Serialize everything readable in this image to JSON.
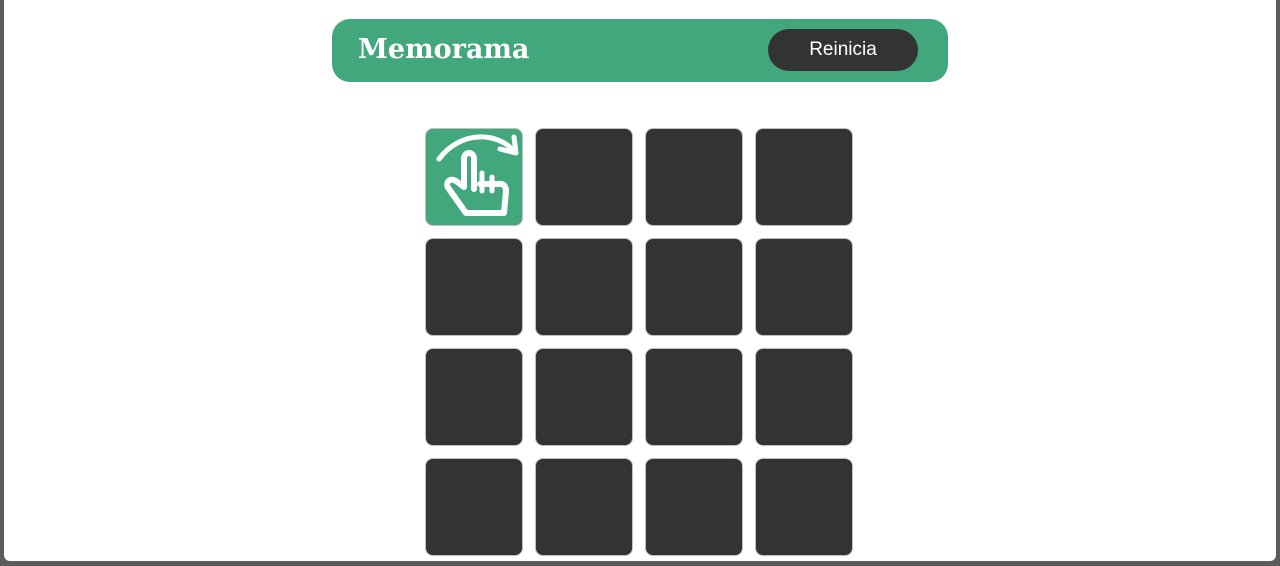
{
  "header": {
    "title": "Memorama",
    "reset_label": "Reinicia"
  },
  "colors": {
    "accent": "#42a77c",
    "card_back": "#333333",
    "button": "#333333",
    "text_on_accent": "#ffffff"
  },
  "board": {
    "rows": 4,
    "columns": 4,
    "cards": [
      {
        "state": "revealed",
        "icon": "tap-flip-icon"
      },
      {
        "state": "hidden"
      },
      {
        "state": "hidden"
      },
      {
        "state": "hidden"
      },
      {
        "state": "hidden"
      },
      {
        "state": "hidden"
      },
      {
        "state": "hidden"
      },
      {
        "state": "hidden"
      },
      {
        "state": "hidden"
      },
      {
        "state": "hidden"
      },
      {
        "state": "hidden"
      },
      {
        "state": "hidden"
      },
      {
        "state": "hidden"
      },
      {
        "state": "hidden"
      },
      {
        "state": "hidden"
      },
      {
        "state": "hidden"
      }
    ]
  }
}
